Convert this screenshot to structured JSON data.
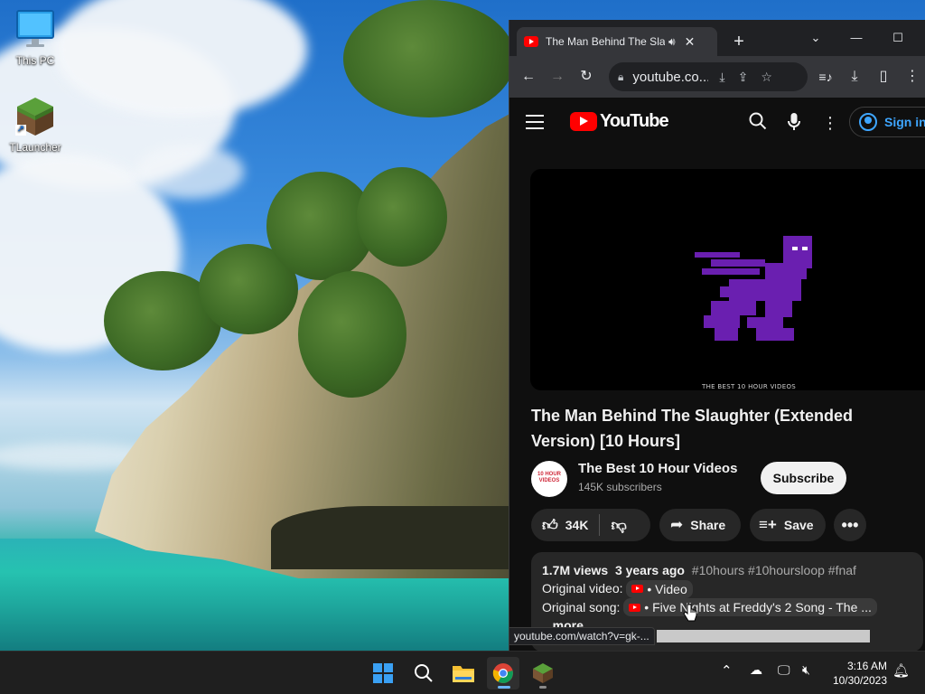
{
  "desktop": {
    "icons": [
      {
        "label": "This PC"
      },
      {
        "label": "TLauncher"
      }
    ]
  },
  "browser": {
    "tab": {
      "title": "The Man Behind The Slaughter (Extended Version) [10 Hours]",
      "audio_icon": "speaker-icon",
      "close": "✕"
    },
    "new_tab": "+",
    "address": {
      "url": "youtube.co..."
    },
    "status_bar_url": "youtube.com/watch?v=gk-..."
  },
  "youtube": {
    "logo_text": "YouTube",
    "sign_in": "Sign in",
    "video_overlay_text": "THE BEST 10 HOUR VIDEOS",
    "title": "The Man Behind The Slaughter (Extended Version) [10 Hours]",
    "channel": {
      "name": "The Best 10 Hour Videos",
      "avatar_text": "10 HOUR VIDEOS",
      "subscribers": "145K subscribers"
    },
    "subscribe_label": "Subscribe",
    "actions": {
      "likes": "34K",
      "share": "Share",
      "save": "Save"
    },
    "description": {
      "views": "1.7M views",
      "age": "3 years ago",
      "hashtags": "#10hours #10hoursloop #fnaf",
      "original_video_label": "Original video:",
      "original_video_chip": "• Video",
      "original_song_label": "Original song:",
      "original_song_chip": "• Five Nights at Freddy's 2 Song - The ...",
      "more": "...more"
    }
  },
  "taskbar": {
    "apps": [
      "start",
      "search",
      "file-explorer",
      "chrome",
      "minecraft-launcher"
    ],
    "time": "3:16 AM",
    "date": "10/30/2023"
  },
  "colors": {
    "yt_red": "#ff0000",
    "yt_bg": "#0f0f0f",
    "link_blue": "#3ea6ff",
    "purple_figure": "#6a1fb0"
  }
}
